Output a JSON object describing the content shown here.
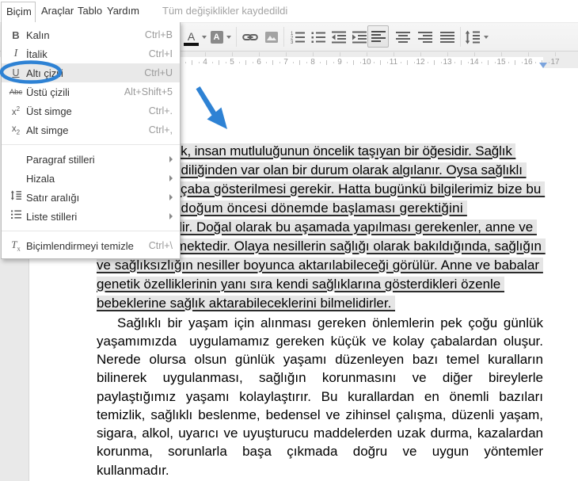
{
  "menubar": {
    "items": [
      {
        "label": "Biçim",
        "open": true
      },
      {
        "label": "Araçlar",
        "open": false
      },
      {
        "label": "Tablo",
        "open": false
      },
      {
        "label": "Yardım",
        "open": false
      }
    ],
    "status": "Tüm değişiklikler kaydedildi"
  },
  "format_menu": {
    "items": [
      {
        "label": "Kalın",
        "shortcut": "Ctrl+B",
        "icon": "bold-icon",
        "glyph": "B"
      },
      {
        "label": "İtalik",
        "shortcut": "Ctrl+I",
        "icon": "italic-icon",
        "glyph": "I"
      },
      {
        "label": "Altı çizili",
        "shortcut": "Ctrl+U",
        "icon": "underline-icon",
        "glyph": "U",
        "highlighted": true
      },
      {
        "label": "Üstü çizili",
        "shortcut": "Alt+Shift+5",
        "icon": "strikethrough-icon",
        "glyph": "Abc"
      },
      {
        "label": "Üst simge",
        "shortcut": "Ctrl+.",
        "icon": "superscript-icon",
        "glyph": "x",
        "glyph2": "2"
      },
      {
        "label": "Alt simge",
        "shortcut": "Ctrl+,",
        "icon": "subscript-icon",
        "glyph": "x",
        "glyph2": "2"
      },
      {
        "label": "Paragraf stilleri",
        "submenu": true
      },
      {
        "label": "Hizala",
        "submenu": true
      },
      {
        "label": "Satır aralığı",
        "submenu": true,
        "icon": "line-spacing-icon"
      },
      {
        "label": "Liste stilleri",
        "submenu": true,
        "icon": "list-styles-icon"
      },
      {
        "label": "Biçimlendirmeyi temizle",
        "shortcut": "Ctrl+\\",
        "icon": "clear-formatting-icon",
        "glyph": "T",
        "glyph2": "x"
      }
    ]
  },
  "toolbar": {
    "text_color_letter": "A",
    "highlight_letter": "A",
    "icons": [
      "text-color",
      "highlight-color",
      "insert-link",
      "insert-image",
      "numbered-list",
      "bulleted-list",
      "outdent",
      "indent",
      "align-left",
      "align-center",
      "align-right",
      "justify",
      "line-spacing"
    ],
    "active": "align-left",
    "numbered_list_digits": [
      "1",
      "2",
      "3"
    ]
  },
  "ruler": {
    "marks": [
      "3",
      "4",
      "5",
      "6",
      "7",
      "8",
      "9",
      "10",
      "11",
      "12",
      "13",
      "14",
      "15",
      "16",
      "17"
    ],
    "right_margin_marker": true
  },
  "document": {
    "paragraph1": {
      "selected": true,
      "underlined": true,
      "lines": [
        "Sağlık, insan mutluluğunun öncelik taşıyan bir öğesidir. Sağlık ",
        "çoğu kez kendiliğinden var olan bir durum olarak algılanır. Oysa sağlıklı ",
        "yaşamak için çaba gösterilmesi gerekir. Hatta bugünkü bilgilerimiz bize bu ",
        "çabanın doğum öncesi dönemde başlaması gerektiğini ",
        "göstermektedir. Doğal olarak bu aşamada yapılması gerekenler, anne ve ",
        "babaya düşmektedir. Olaya nesillerin sağlığı olarak bakıldığında, sağlığın ",
        "ve sağlıksızlığın nesiller boyunca aktarılabileceği görülür. Anne ve babalar ",
        "genetik özelliklerinin yanı sıra kendi sağlıklarına gösterdikleri özenle ",
        "bebeklerine sağlık aktarabileceklerini bilmelidirler. "
      ]
    },
    "paragraph2": {
      "justified": true,
      "lines": [
        "Sağlıklı bir yaşam için alınması gereken önlemlerin pek çoğu günlük",
        "yaşamımızda  uygulamamız gereken küçük ve kolay çabalardan oluşur.",
        "Nerede olursa olsun günlük yaşamı düzenleyen bazı temel kuralların",
        "bilinerek uygulanması, sağlığın korunmasını ve diğer bireylerle",
        "paylaştığımız yaşamı kolaylaştırır. Bu kurallardan en önemli bazıları",
        "temizlik, sağlıklı beslenme, bedensel ve zihinsel çalışma, düzenli yaşam,",
        "sigara, alkol, uyarıcı ve uyuşturucu maddelerden uzak durma, kazalardan",
        "korunma, sorunlarla başa çıkmada doğru ve uygun yöntemler",
        "kullanmadır."
      ]
    }
  },
  "annotations": {
    "arrow": {
      "shape": "down-right-arrow"
    },
    "ellipse": {
      "around": "underline-icon"
    }
  },
  "colors": {
    "accent_blue": "#2e82d4",
    "selection_gray": "#e5e5e5",
    "ruler_marker_blue": "#7ba4dd"
  }
}
